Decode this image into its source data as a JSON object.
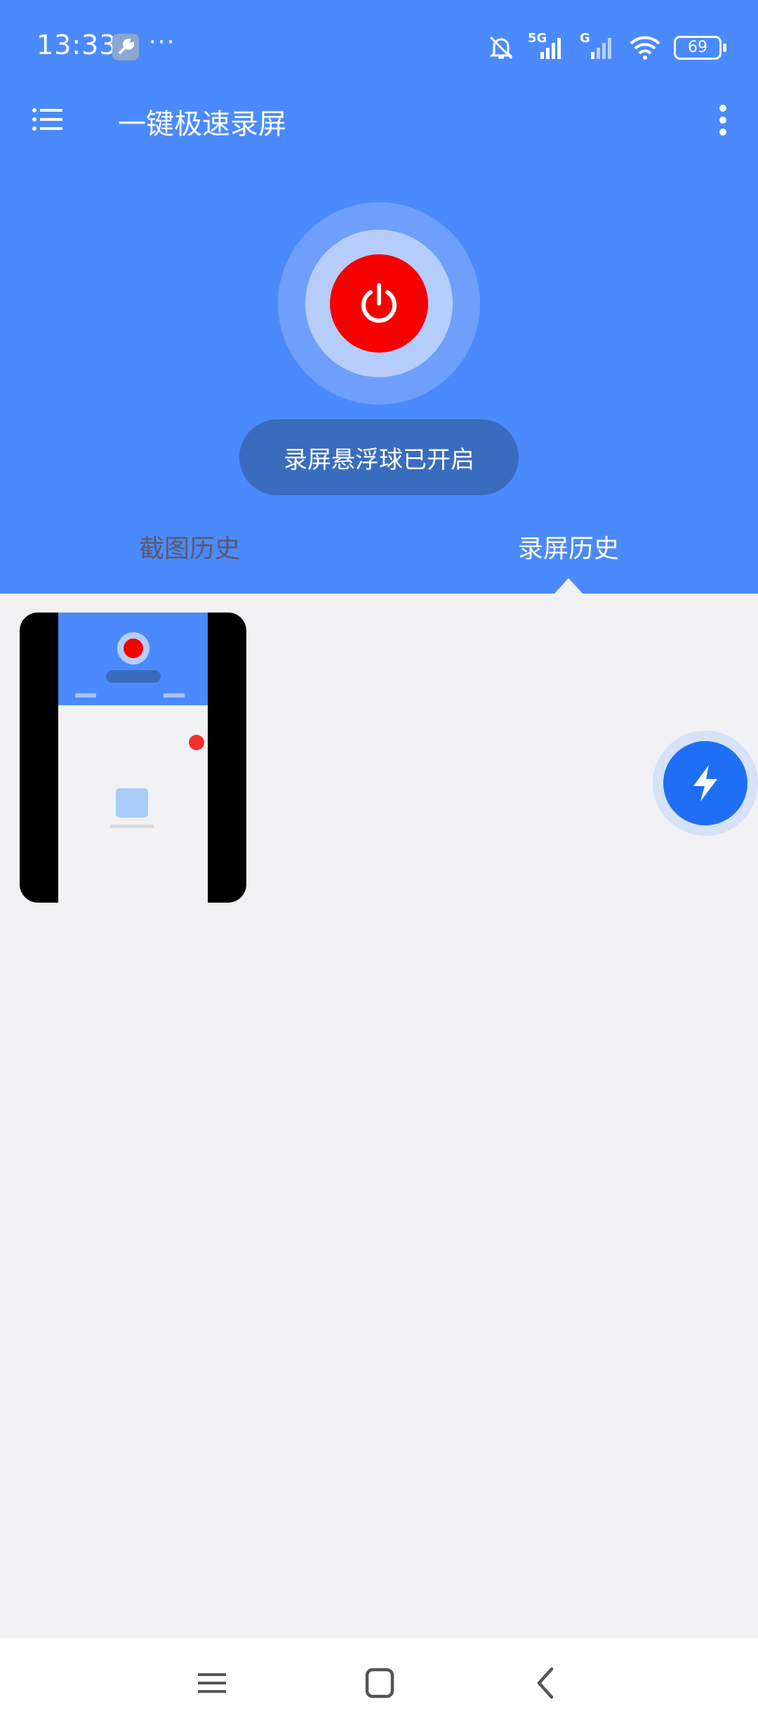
{
  "status_bar": {
    "time": "13:33",
    "overflow": "···",
    "network_1": "5G",
    "network_2": "G",
    "battery": "69",
    "icons": [
      "wrench-icon",
      "bell-off-icon",
      "signal-icon",
      "wifi-icon",
      "battery-icon"
    ]
  },
  "toolbar": {
    "title": "一键极速录屏",
    "menu_icon": "menu-icon",
    "more_icon": "more-vertical-icon"
  },
  "recorder": {
    "power_icon": "power-icon",
    "status": "录屏悬浮球已开启",
    "accent_color": "#f60000"
  },
  "tabs": [
    {
      "label": "截图历史",
      "selected": false
    },
    {
      "label": "录屏历史",
      "selected": true
    }
  ],
  "history": {
    "items": [
      {
        "type": "video-thumbnail"
      }
    ]
  },
  "fab": {
    "icon": "lightning-icon",
    "color": "#1e6ff6"
  },
  "nav": {
    "recents_icon": "recents-icon",
    "home_icon": "home-icon",
    "back_icon": "back-icon"
  },
  "theme": {
    "primary": "#4b8afc",
    "background": "#f1f1f3"
  }
}
